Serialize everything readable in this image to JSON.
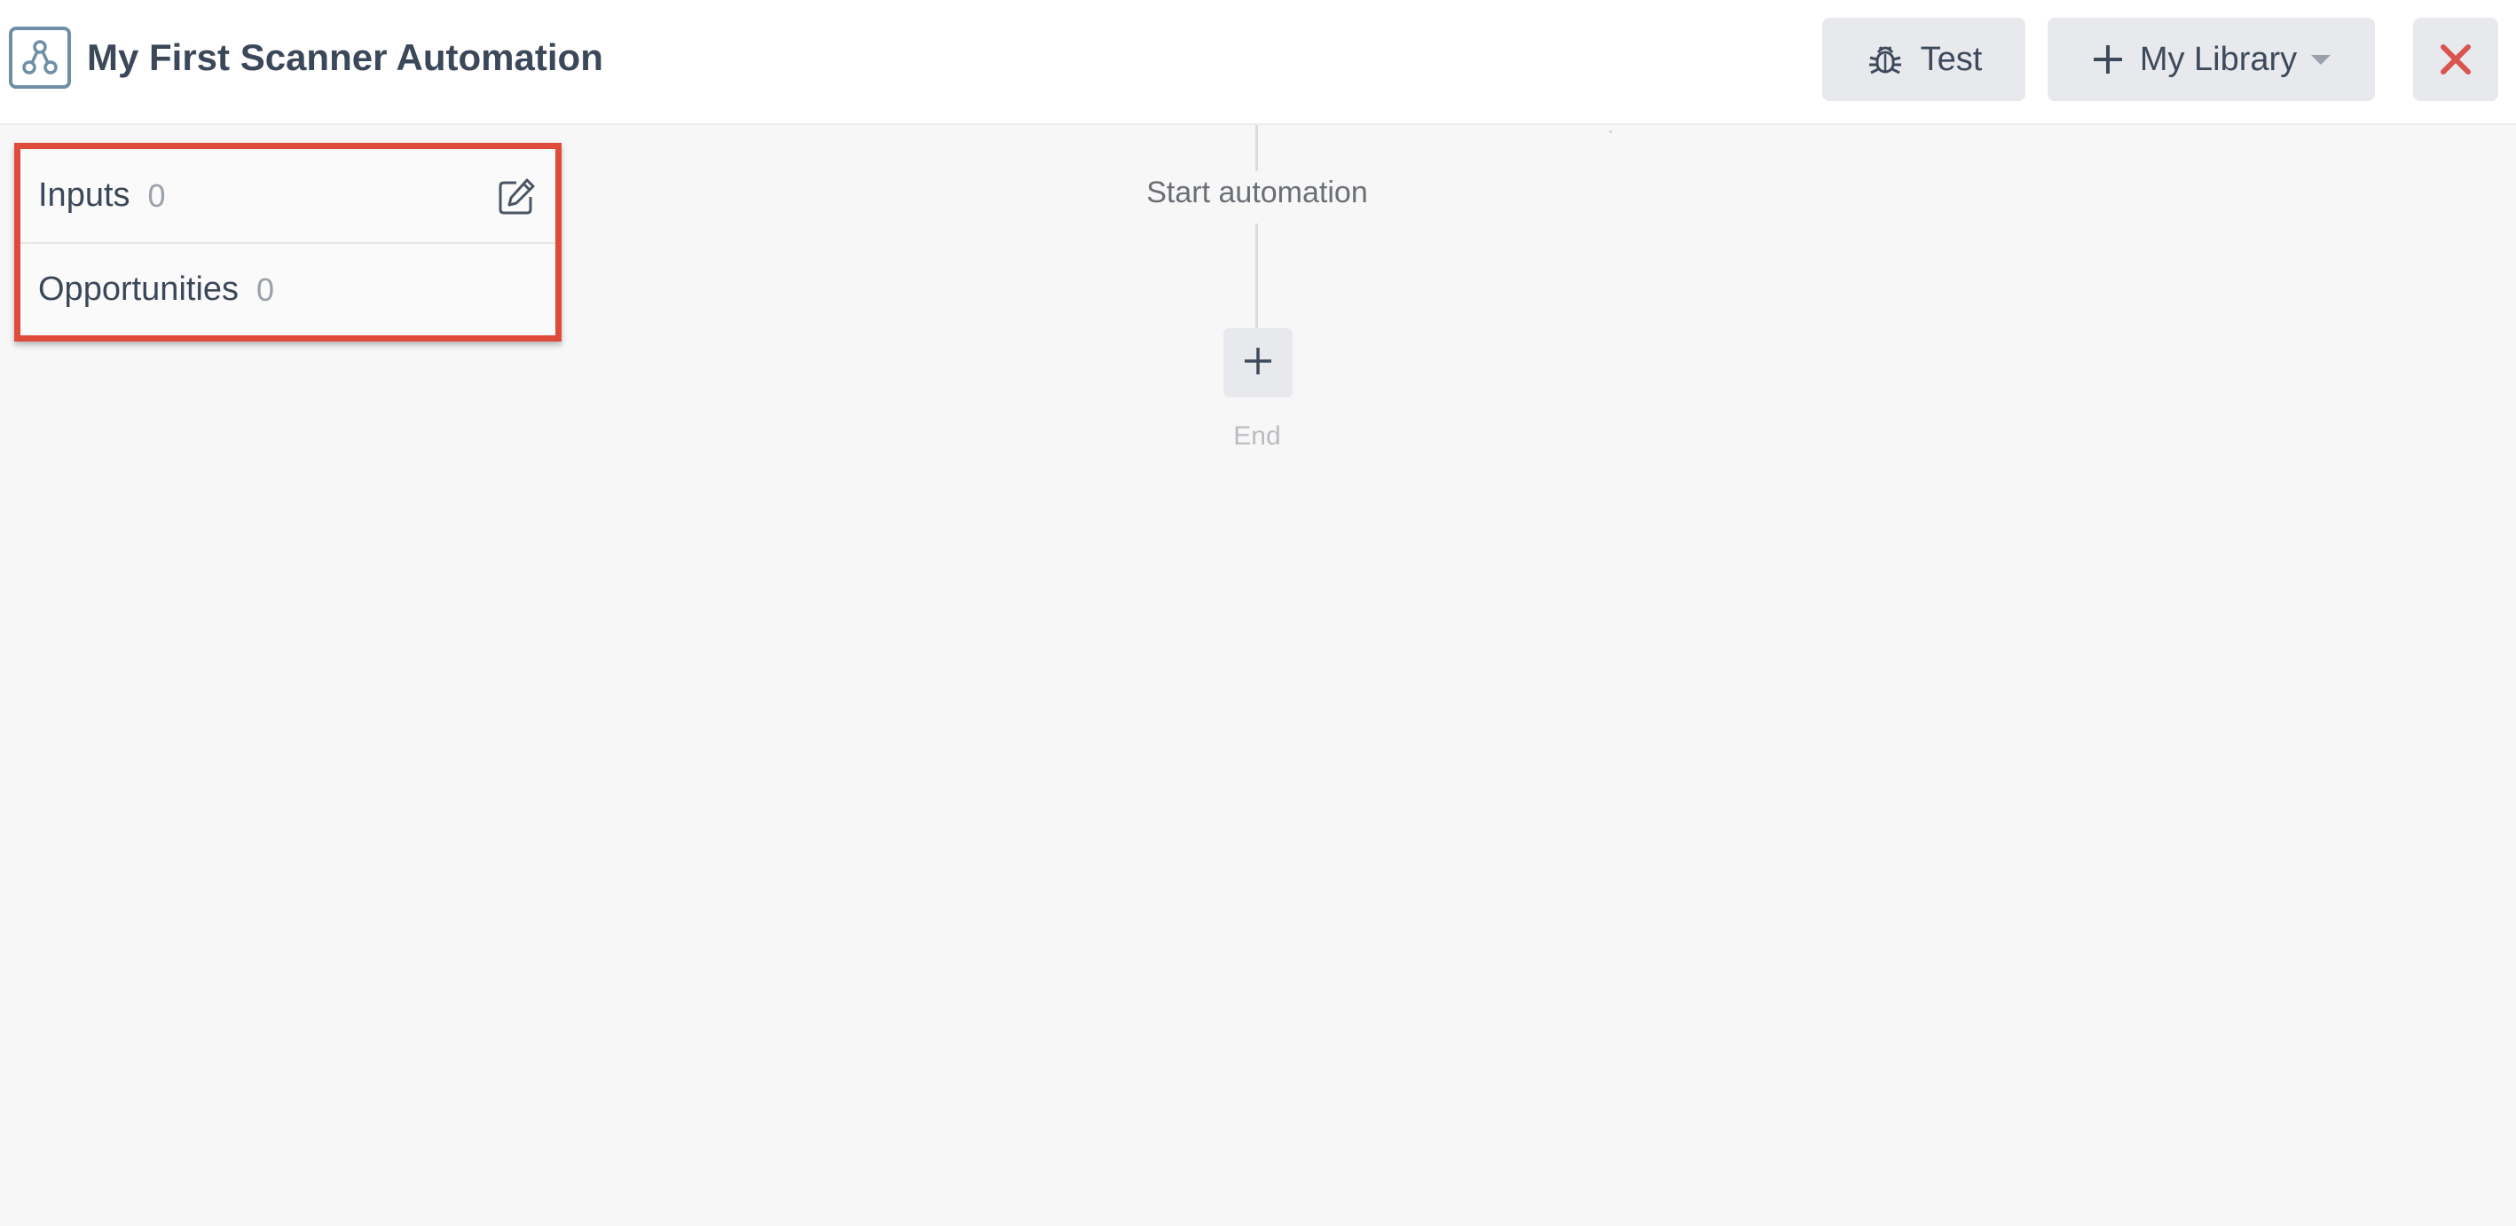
{
  "header": {
    "title": "My First Scanner Automation",
    "logo_icon": "workflow-nodes-icon",
    "test_button": {
      "label": "Test",
      "icon": "bug-icon"
    },
    "library_button": {
      "label": "My Library",
      "icon": "plus-icon",
      "dropdown_icon": "caret-down-icon"
    },
    "close_button": {
      "icon": "close-icon",
      "color": "#d9534f"
    }
  },
  "panel": {
    "rows": [
      {
        "label": "Inputs",
        "count": "0",
        "action_icon": "edit-icon"
      },
      {
        "label": "Opportunities",
        "count": "0"
      }
    ],
    "highlight_color": "#df4b3b"
  },
  "flow": {
    "start_label": "Start automation",
    "add_step_icon": "plus-icon",
    "end_label": "End"
  }
}
